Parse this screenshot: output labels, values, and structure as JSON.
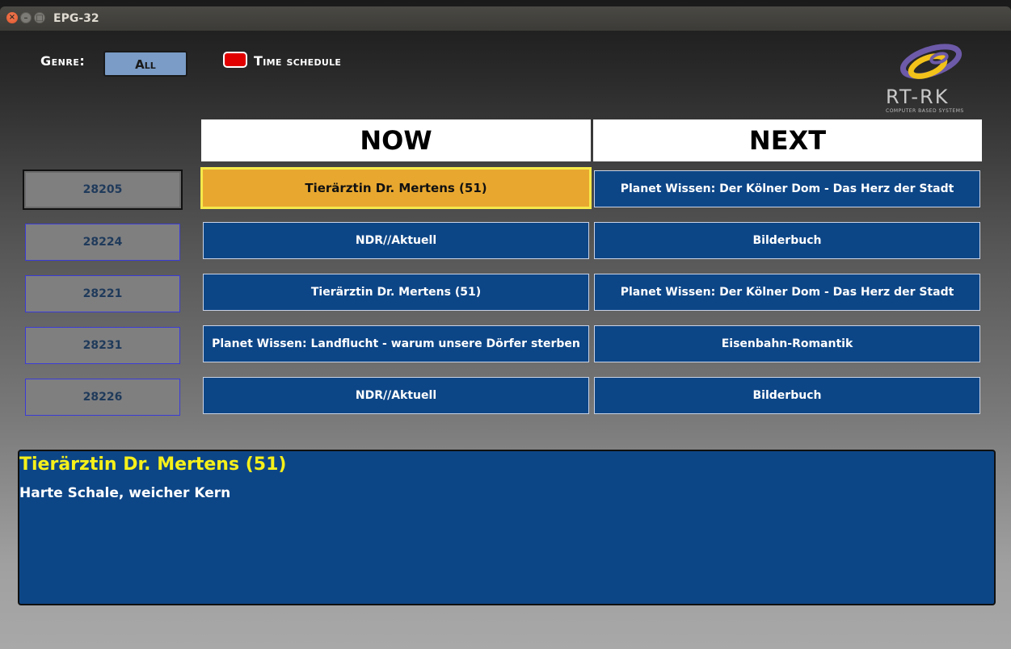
{
  "window": {
    "title": "EPG-32",
    "controls": [
      "close",
      "minimize",
      "maximize"
    ]
  },
  "header": {
    "genre_label": "Genre:",
    "genre_value": "All",
    "time_schedule_label": "Time schedule",
    "time_schedule_key_color": "#e00000"
  },
  "logo": {
    "text": "RT-RK",
    "subtext": "COMPUTER BASED SYSTEMS"
  },
  "columns": {
    "now": "NOW",
    "next": "NEXT"
  },
  "channels": [
    {
      "number": "28205",
      "now": "Tierärztin Dr. Mertens (51)",
      "next": "Planet Wissen: Der Kölner Dom - Das Herz der Stadt",
      "selected": true
    },
    {
      "number": "28224",
      "now": "NDR//Aktuell",
      "next": "Bilderbuch",
      "selected": false
    },
    {
      "number": "28221",
      "now": "Tierärztin Dr. Mertens (51)",
      "next": "Planet Wissen: Der Kölner Dom - Das Herz der Stadt",
      "selected": false
    },
    {
      "number": "28231",
      "now": "Planet Wissen: Landflucht - warum unsere Dörfer sterben",
      "next": "Eisenbahn-Romantik",
      "selected": false
    },
    {
      "number": "28226",
      "now": "NDR//Aktuell",
      "next": "Bilderbuch",
      "selected": false
    }
  ],
  "details": {
    "title": "Tierärztin Dr. Mertens (51)",
    "description": "Harte Schale, weicher Kern"
  },
  "colors": {
    "program_bg": "#0d4687",
    "active_bg": "#e8a830",
    "active_border": "#f5e84a",
    "title_yellow": "#f5f01a"
  }
}
